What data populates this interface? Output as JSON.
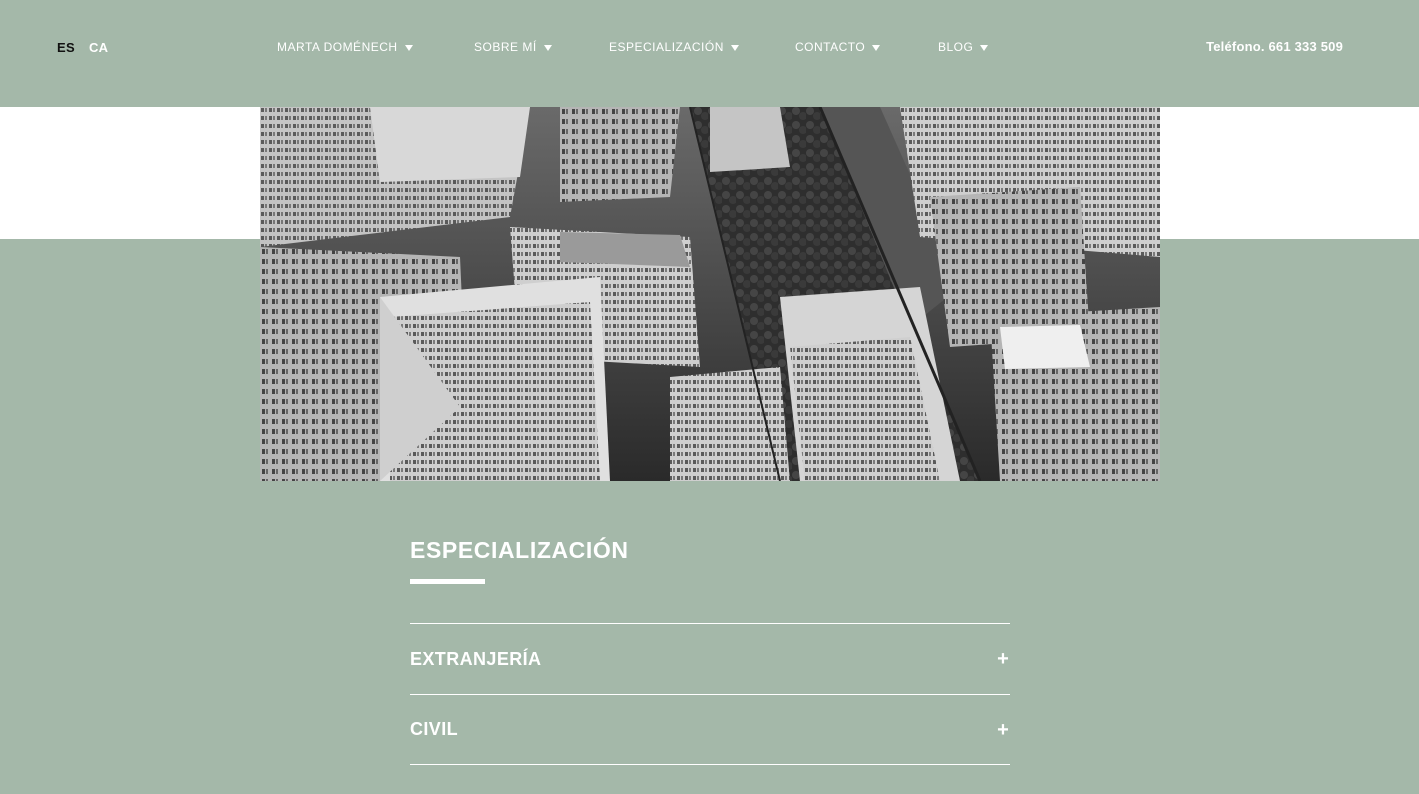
{
  "lang": [
    {
      "label": "ES",
      "active": true
    },
    {
      "label": "CA",
      "active": false
    }
  ],
  "nav": {
    "items": [
      {
        "label": "MARTA DOMÉNECH"
      },
      {
        "label": "SOBRE MÍ"
      },
      {
        "label": "ESPECIALIZACIÓN"
      },
      {
        "label": "CONTACTO"
      },
      {
        "label": "BLOG"
      }
    ]
  },
  "phone": "Teléfono. 661 333 509",
  "hero": {
    "image": "city-aerial-photo"
  },
  "section": {
    "title": "ESPECIALIZACIÓN"
  },
  "accordion": [
    {
      "label": "EXTRANJERÍA",
      "icon": "+"
    },
    {
      "label": "CIVIL",
      "icon": "+"
    }
  ],
  "colors": {
    "background": "#a4b8a9",
    "text": "#ffffff",
    "active_lang": "#111111"
  }
}
